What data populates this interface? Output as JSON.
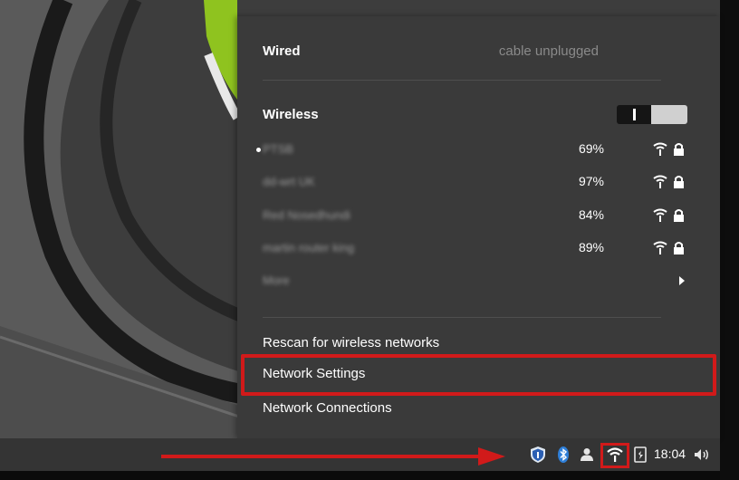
{
  "popup": {
    "wired": {
      "label": "Wired",
      "status": "cable unplugged"
    },
    "wireless": {
      "label": "Wireless",
      "enabled": true
    },
    "networks": [
      {
        "name": "PTSB",
        "signal": "69%",
        "connected": true,
        "secured": true
      },
      {
        "name": "dd-wrt UK",
        "signal": "97%",
        "connected": false,
        "secured": true
      },
      {
        "name": "Red Nosedhundi",
        "signal": "84%",
        "connected": false,
        "secured": true
      },
      {
        "name": "martin router king",
        "signal": "89%",
        "connected": false,
        "secured": true
      }
    ],
    "more_label": "More",
    "actions": {
      "rescan": "Rescan for wireless networks",
      "settings": "Network Settings",
      "connections": "Network Connections"
    }
  },
  "taskbar": {
    "clock": "18:04",
    "tray_icons": [
      "shield-update-icon",
      "bluetooth-icon",
      "user-icon",
      "network-wifi-icon",
      "battery-icon",
      "volume-icon"
    ]
  },
  "colors": {
    "popup_bg": "#3a3a3a",
    "taskbar_bg": "#343434",
    "highlight_red": "#d11a1a",
    "accent_green": "#8fc31f"
  }
}
